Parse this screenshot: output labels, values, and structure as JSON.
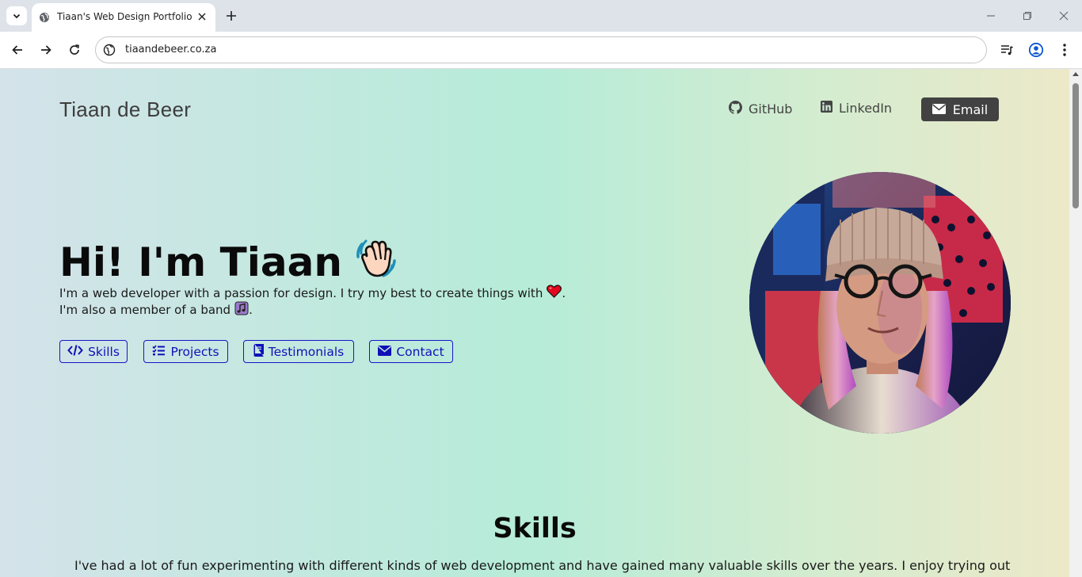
{
  "browser": {
    "tab_title": "Tiaan's Web Design Portfolio",
    "url": "tiaandebeer.co.za"
  },
  "header": {
    "brand": "Tiaan de Beer",
    "nav": {
      "github": "GitHub",
      "linkedin": "LinkedIn",
      "email": "Email"
    }
  },
  "hero": {
    "title": "Hi! I'm Tiaan",
    "line1": "I'm a web developer with a passion for design. I try my best to create things with",
    "line1_end": ".",
    "line2": "I'm also a member of a band",
    "line2_end": ".",
    "buttons": {
      "skills": "Skills",
      "projects": "Projects",
      "testimonials": "Testimonials",
      "contact": "Contact"
    }
  },
  "skills": {
    "title": "Skills",
    "text": "I've had a lot of fun experimenting with different kinds of web development and have gained many valuable skills over the years. I enjoy trying out"
  },
  "colors": {
    "accent": "#1515c8",
    "email_button": "#424242",
    "gradient": [
      "#d4e3ea",
      "#b6ecd8",
      "#ece9c8"
    ]
  },
  "icons": [
    "tab-search-icon",
    "globe-icon",
    "close-icon",
    "plus-icon",
    "minimize-icon",
    "restore-icon",
    "back-icon",
    "forward-icon",
    "reload-icon",
    "site-info-icon",
    "media-icon",
    "profile-icon",
    "menu-icon",
    "github-icon",
    "linkedin-icon",
    "envelope-icon",
    "waving-hand-emoji",
    "heart-emoji",
    "music-notes-emoji",
    "code-icon",
    "tasks-icon",
    "book-icon"
  ]
}
